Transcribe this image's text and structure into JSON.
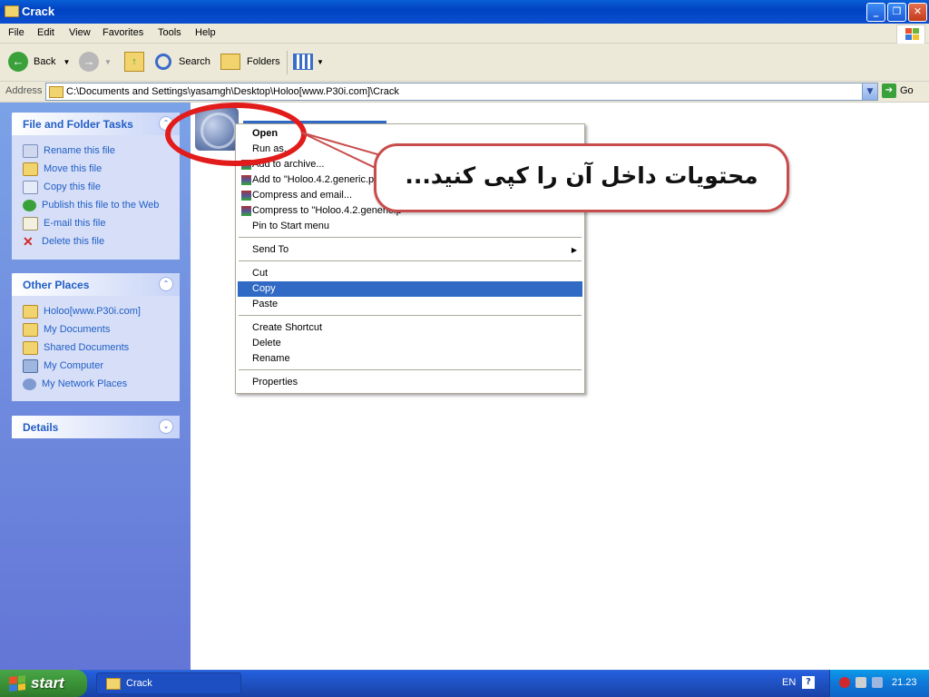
{
  "window": {
    "title": "Crack"
  },
  "menu": [
    "File",
    "Edit",
    "View",
    "Favorites",
    "Tools",
    "Help"
  ],
  "toolbar": {
    "back": "Back",
    "search": "Search",
    "folders": "Folders"
  },
  "address": {
    "label": "Address",
    "path": "C:\\Documents and Settings\\yasamgh\\Desktop\\Holoo[www.P30i.com]\\Crack",
    "go": "Go"
  },
  "sidebar": {
    "tasks": {
      "title": "File and Folder Tasks",
      "items": [
        "Rename this file",
        "Move this file",
        "Copy this file",
        "Publish this file to the Web",
        "E-mail this file",
        "Delete this file"
      ]
    },
    "places": {
      "title": "Other Places",
      "items": [
        "Holoo[www.P30i.com]",
        "My Documents",
        "Shared Documents",
        "My Computer",
        "My Network Places"
      ]
    },
    "details": {
      "title": "Details"
    }
  },
  "context_menu": {
    "open": "Open",
    "run_as": "Run as...",
    "add_archive": "Add to archive...",
    "add_to": "Add to \"Holoo.4.2.generic.p",
    "compress_email": "Compress and email...",
    "compress_to": "Compress to \"Holoo.4.2.generic.p",
    "pin": "Pin to Start menu",
    "send_to": "Send To",
    "cut": "Cut",
    "copy": "Copy",
    "paste": "Paste",
    "create_shortcut": "Create Shortcut",
    "delete": "Delete",
    "rename": "Rename",
    "properties": "Properties"
  },
  "callout": {
    "text": "محتویات داخل آن را کپی کنید..."
  },
  "taskbar": {
    "start": "start",
    "task": "Crack",
    "lang": "EN",
    "clock": "21.23"
  },
  "colors": {
    "xp_blue": "#0a5fd6",
    "selection": "#316ac5",
    "annotation_red": "#e21b1b"
  }
}
